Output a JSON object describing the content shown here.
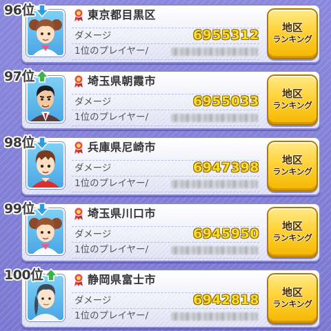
{
  "colors": {
    "rank_up": "#3cb34a",
    "rank_down": "#2f9be3",
    "damage_value": "#ffdc2a",
    "button": "#ffd236"
  },
  "rows": [
    {
      "rank": "96位",
      "trend": "down",
      "avatar": "girl-pigtails",
      "location": "東京都目黒区",
      "damage_label": "ダメージ",
      "damage_value": "6955312",
      "top_player_label": "1位のプレイヤー/",
      "button_line1": "地区",
      "button_line2": "ランキング"
    },
    {
      "rank": "97位",
      "trend": "up",
      "avatar": "man-suit",
      "location": "埼玉県朝霞市",
      "damage_label": "ダメージ",
      "damage_value": "6955033",
      "top_player_label": "1位のプレイヤー/",
      "button_line1": "地区",
      "button_line2": "ランキング"
    },
    {
      "rank": "98位",
      "trend": "down",
      "avatar": "boy-red-shirt",
      "location": "兵庫県尼崎市",
      "damage_label": "ダメージ",
      "damage_value": "6947398",
      "top_player_label": "1位のプレイヤー/",
      "button_line1": "地区",
      "button_line2": "ランキング"
    },
    {
      "rank": "99位",
      "trend": "down",
      "avatar": "girl-pigtails",
      "location": "埼玉県川口市",
      "damage_label": "ダメージ",
      "damage_value": "6945950",
      "top_player_label": "1位のプレイヤー/",
      "button_line1": "地区",
      "button_line2": "ランキング"
    },
    {
      "rank": "100位",
      "trend": "up",
      "avatar": "woman-braid",
      "location": "静岡県富士市",
      "damage_label": "ダメージ",
      "damage_value": "6942818",
      "top_player_label": "1位のプレイヤー/",
      "button_line1": "地区",
      "button_line2": "ランキング"
    }
  ]
}
